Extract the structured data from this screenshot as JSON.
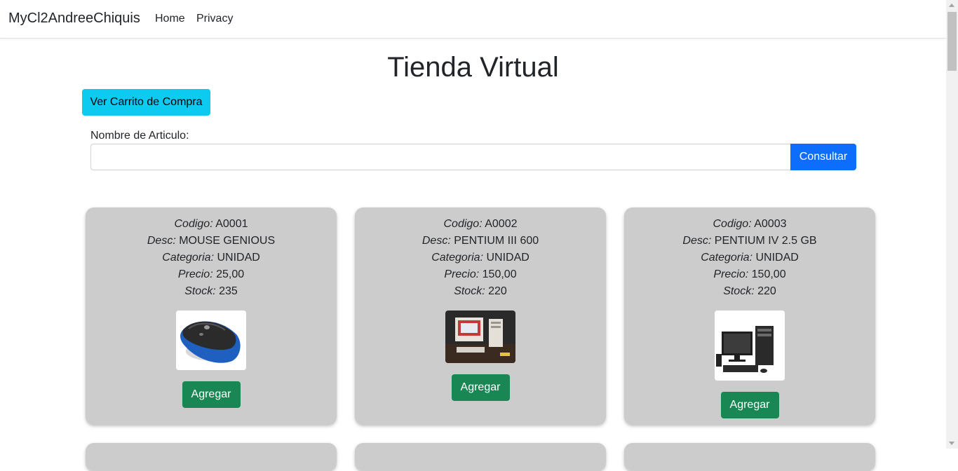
{
  "navbar": {
    "brand": "MyCl2AndreeChiquis",
    "links": [
      "Home",
      "Privacy"
    ]
  },
  "page": {
    "title": "Tienda Virtual",
    "cart_button": "Ver Carrito de Compra",
    "search_label": "Nombre de Articulo:",
    "search_value": "",
    "search_button": "Consultar"
  },
  "field_labels": {
    "codigo": "Codigo:",
    "desc": "Desc:",
    "categoria": "Categoria:",
    "precio": "Precio:",
    "stock": "Stock:"
  },
  "products": [
    {
      "codigo": "A0001",
      "desc": "MOUSE GENIOUS",
      "categoria": "UNIDAD",
      "precio": "25,00",
      "stock": "235",
      "image": "mouse-image",
      "add_label": "Agregar"
    },
    {
      "codigo": "A0002",
      "desc": "PENTIUM III 600",
      "categoria": "UNIDAD",
      "precio": "150,00",
      "stock": "220",
      "image": "desktop-computer-image",
      "add_label": "Agregar"
    },
    {
      "codigo": "A0003",
      "desc": "PENTIUM IV 2.5 GB",
      "categoria": "UNIDAD",
      "precio": "150,00",
      "stock": "220",
      "image": "desktop-computer-image",
      "add_label": "Agregar"
    }
  ],
  "colors": {
    "info": "#0dcaf0",
    "primary": "#0d6efd",
    "success": "#198754",
    "card_bg": "#cccccc"
  }
}
